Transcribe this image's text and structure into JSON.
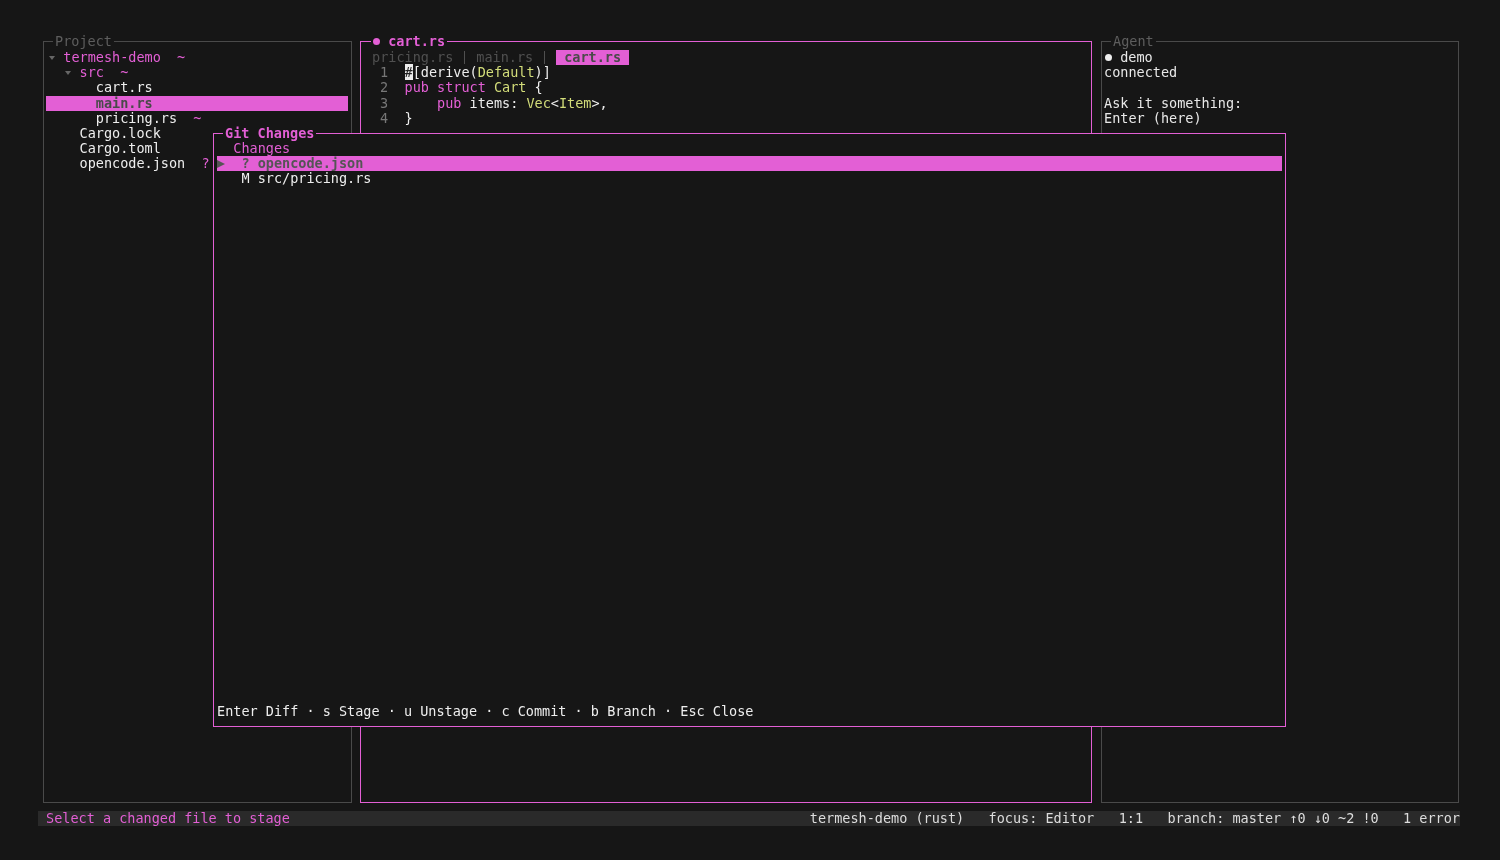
{
  "project": {
    "title": "Project",
    "tree": [
      {
        "name": "termesh-demo",
        "kind": "dir",
        "expanded": true,
        "selected": false,
        "marker": "~",
        "children": [
          {
            "name": "src",
            "kind": "dir",
            "expanded": true,
            "selected": false,
            "marker": "~",
            "children": [
              {
                "name": "cart.rs",
                "kind": "file",
                "selected": false
              },
              {
                "name": "main.rs",
                "kind": "file",
                "selected": true
              },
              {
                "name": "pricing.rs",
                "kind": "file",
                "selected": false,
                "marker": "~"
              }
            ]
          },
          {
            "name": "Cargo.lock",
            "kind": "file",
            "selected": false
          },
          {
            "name": "Cargo.toml",
            "kind": "file",
            "selected": false
          },
          {
            "name": "opencode.json",
            "kind": "file",
            "selected": false,
            "marker": "?"
          }
        ]
      }
    ]
  },
  "editor": {
    "title": "cart.rs",
    "modified": true,
    "tabs": [
      {
        "label": "pricing.rs",
        "selected": false
      },
      {
        "label": "main.rs",
        "selected": false
      },
      {
        "label": "cart.rs",
        "selected": true
      }
    ],
    "lines": [
      {
        "number": "1",
        "tokens": [
          {
            "text": "#",
            "kind": "cursor"
          },
          {
            "text": "[derive(",
            "kind": "plain"
          },
          {
            "text": "Default",
            "kind": "type"
          },
          {
            "text": ")]",
            "kind": "plain"
          }
        ]
      },
      {
        "number": "2",
        "tokens": [
          {
            "text": "pub struct",
            "kind": "keyword"
          },
          {
            "text": " Cart",
            "kind": "type"
          },
          {
            "text": " {",
            "kind": "plain"
          }
        ]
      },
      {
        "number": "3",
        "tokens": [
          {
            "text": "    pub",
            "kind": "keyword"
          },
          {
            "text": " items: ",
            "kind": "plain"
          },
          {
            "text": "Vec",
            "kind": "type"
          },
          {
            "text": "<",
            "kind": "plain"
          },
          {
            "text": "Item",
            "kind": "type"
          },
          {
            "text": ">,",
            "kind": "plain"
          }
        ]
      },
      {
        "number": "4",
        "tokens": [
          {
            "text": "}",
            "kind": "plain"
          }
        ]
      }
    ]
  },
  "agent": {
    "title": "Agent",
    "name": "demo",
    "status": "connected",
    "prompt": "Ask it something:",
    "input": "Enter (here)"
  },
  "git_changes": {
    "title": "Git Changes",
    "section": "Changes",
    "items": [
      {
        "status": "?",
        "path": "opencode.json",
        "selected": true
      },
      {
        "status": "M",
        "path": "src/pricing.rs",
        "selected": false
      }
    ],
    "hint": "Enter Diff · s Stage · u Unstage · c Commit · b Branch · Esc Close"
  },
  "status_bar": {
    "message": "Select a changed file to stage",
    "items": [
      "termesh-demo (rust)",
      "focus: Editor",
      "1:1",
      "branch: master ↑0 ↓0 ~2 !0",
      "1 error"
    ]
  }
}
